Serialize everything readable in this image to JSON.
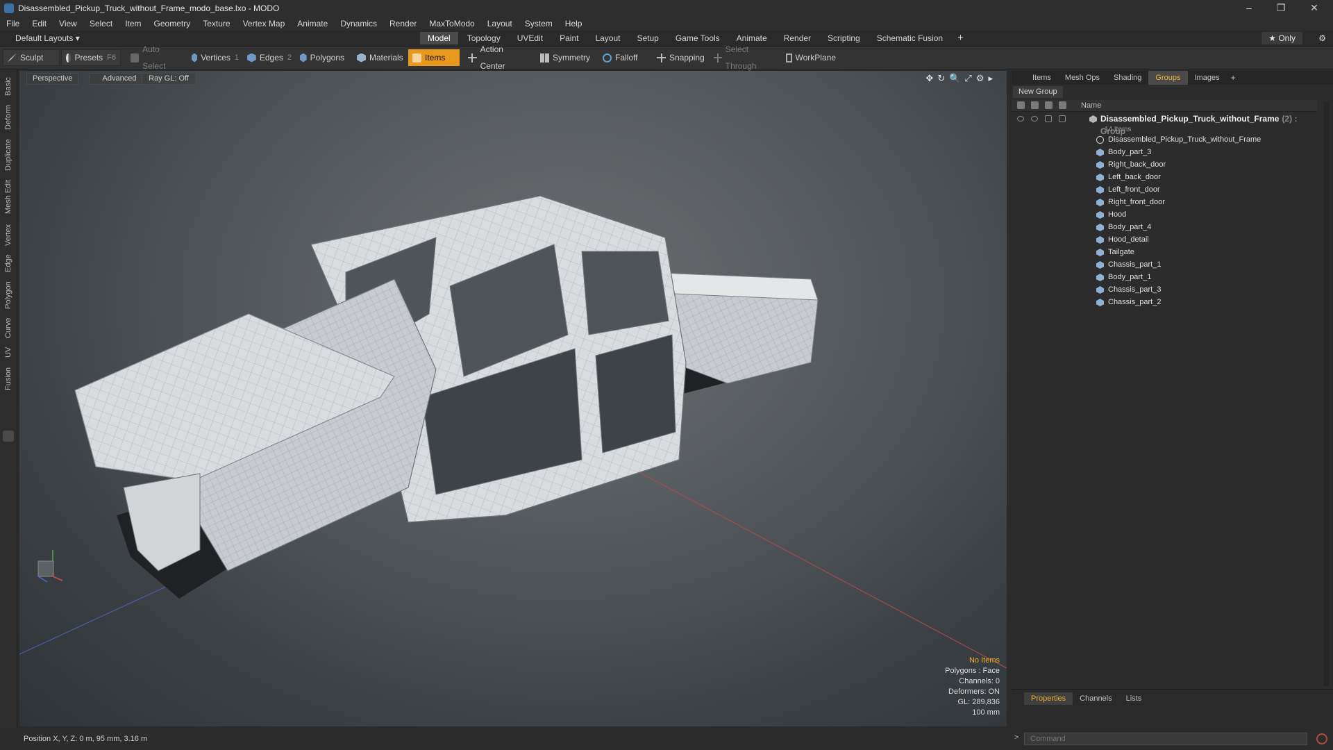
{
  "window": {
    "title": "Disassembled_Pickup_Truck_without_Frame_modo_base.lxo - MODO",
    "controls": [
      "–",
      "❐",
      "✕"
    ]
  },
  "menu": [
    "File",
    "Edit",
    "View",
    "Select",
    "Item",
    "Geometry",
    "Texture",
    "Vertex Map",
    "Animate",
    "Dynamics",
    "Render",
    "MaxToModo",
    "Layout",
    "System",
    "Help"
  ],
  "layoutbar": {
    "layout_select": "Default Layouts ▾",
    "tabs": [
      "Model",
      "Topology",
      "UVEdit",
      "Paint",
      "Layout",
      "Setup",
      "Game Tools",
      "Animate",
      "Render",
      "Scripting",
      "Schematic Fusion"
    ],
    "active_tab": "Model",
    "plus": "+",
    "only": "★  Only",
    "gear": "⚙"
  },
  "toolbar": {
    "sculpt": "Sculpt",
    "presets": "Presets",
    "presets_hotkey": "F6",
    "auto_select": "Auto Select",
    "vertices": "Vertices",
    "vertices_count": "1",
    "edges": "Edges",
    "edges_count": "2",
    "polygons": "Polygons",
    "materials": "Materials",
    "items": "Items",
    "action_center": "Action Center",
    "symmetry": "Symmetry",
    "falloff": "Falloff",
    "snapping": "Snapping",
    "select_through": "Select Through",
    "workplane": "WorkPlane"
  },
  "left_tabs": [
    "Basic",
    "Deform",
    "Duplicate",
    "Mesh Edit",
    "Vertex",
    "Edge",
    "Polygon",
    "Curve",
    "UV",
    "Fusion"
  ],
  "viewport": {
    "perspective": "Perspective",
    "advanced": "Advanced",
    "raygl": "Ray GL: Off",
    "icons": [
      "✥",
      "↻",
      "🔍",
      "⤢",
      "⚙",
      "▸"
    ],
    "info": {
      "no_items": "No Items",
      "polygons": "Polygons : Face",
      "channels": "Channels: 0",
      "deformers": "Deformers: ON",
      "gl": "GL: 289,836",
      "scale": "100 mm"
    }
  },
  "right_panel": {
    "tabs": [
      "Items",
      "Mesh Ops",
      "Shading",
      "Groups",
      "Images"
    ],
    "active_tab": "Groups",
    "plus": "+",
    "new_group": "New Group",
    "column_name": "Name",
    "group": {
      "name": "Disassembled_Pickup_Truck_without_Frame",
      "tag": "(2) : Group",
      "count": "14 Items"
    },
    "items": [
      {
        "label": "Disassembled_Pickup_Truck_without_Frame",
        "icon": "locator-icon"
      },
      {
        "label": "Body_part_3",
        "icon": "mesh-icon"
      },
      {
        "label": "Right_back_door",
        "icon": "mesh-icon"
      },
      {
        "label": "Left_back_door",
        "icon": "mesh-icon"
      },
      {
        "label": "Left_front_door",
        "icon": "mesh-icon"
      },
      {
        "label": "Right_front_door",
        "icon": "mesh-icon"
      },
      {
        "label": "Hood",
        "icon": "mesh-icon"
      },
      {
        "label": "Body_part_4",
        "icon": "mesh-icon"
      },
      {
        "label": "Hood_detail",
        "icon": "mesh-icon"
      },
      {
        "label": "Tailgate",
        "icon": "mesh-icon"
      },
      {
        "label": "Chassis_part_1",
        "icon": "mesh-icon"
      },
      {
        "label": "Body_part_1",
        "icon": "mesh-icon"
      },
      {
        "label": "Chassis_part_3",
        "icon": "mesh-icon"
      },
      {
        "label": "Chassis_part_2",
        "icon": "mesh-icon"
      }
    ],
    "properties_tabs": [
      "Properties",
      "Channels",
      "Lists"
    ],
    "properties_active": "Properties"
  },
  "status": {
    "position": "Position X, Y, Z:  0 m, 95 mm, 3.16 m"
  },
  "command": {
    "prompt": ">",
    "placeholder": "Command"
  },
  "colors": {
    "accent": "#e9981e",
    "active_tab_text": "#f0b030"
  }
}
